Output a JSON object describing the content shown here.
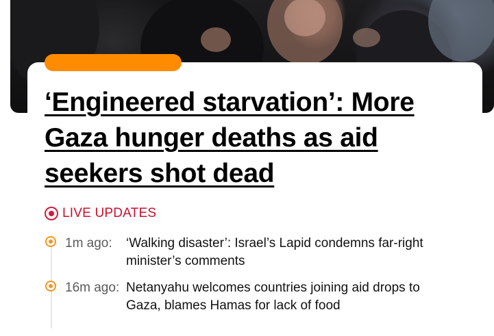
{
  "hero": {
    "image_description_icon": "photo-icon"
  },
  "article": {
    "headline": "‘Engineered starvation’: More Gaza hunger deaths as aid seekers shot dead",
    "accent_color": "#ff8c00"
  },
  "live": {
    "label": "LIVE UPDATES",
    "color": "#c8102e",
    "icon": "live-icon"
  },
  "updates": [
    {
      "time": "1m ago:",
      "text": "‘Walking disaster’: Israel’s Lapid condemns far-right minister’s comments"
    },
    {
      "time": "16m ago:",
      "text": "Netanyahu welcomes countries joining aid drops to Gaza, blames Hamas for lack of food"
    }
  ]
}
